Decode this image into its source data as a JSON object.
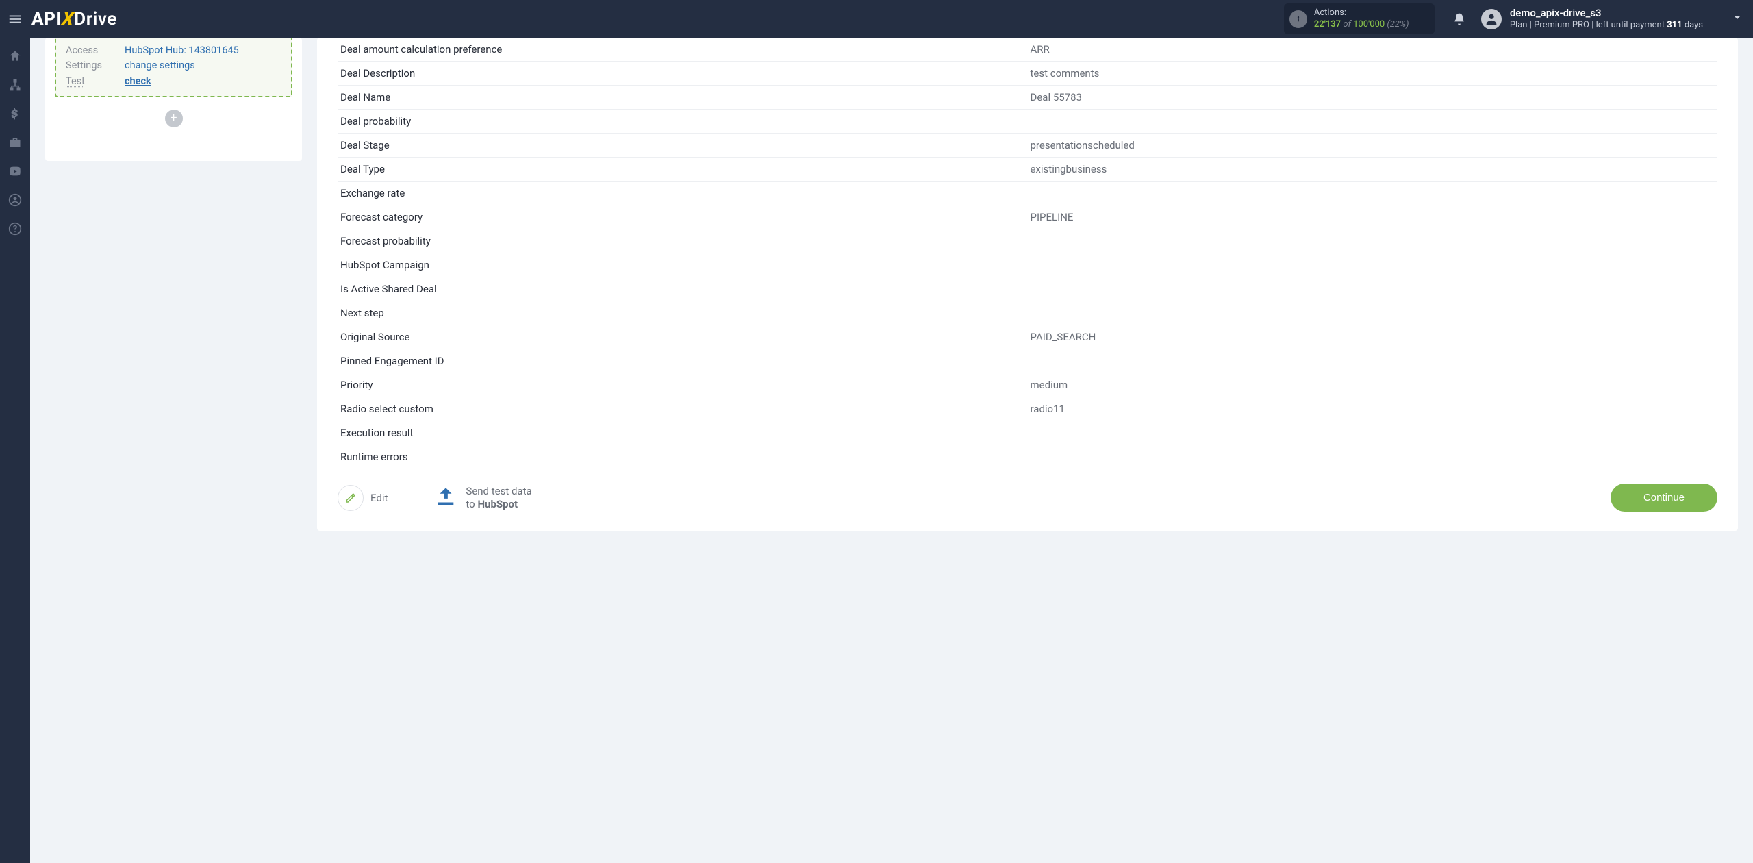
{
  "header": {
    "logo_pre": "API",
    "logo_x": "X",
    "logo_post": "Drive",
    "actions_label": "Actions:",
    "actions_used": "22'137",
    "actions_of": " of ",
    "actions_total": "100'000",
    "actions_pct": " (22%)",
    "user_name": "demo_apix-drive_s3",
    "plan_prefix": "Plan |",
    "plan_name": "Premium PRO",
    "plan_mid": "| left until payment ",
    "plan_days": "311",
    "plan_suffix": " days"
  },
  "sidebar": {
    "icons": [
      "home",
      "sitemap",
      "dollar",
      "briefcase",
      "youtube",
      "user",
      "help"
    ]
  },
  "step": {
    "access_label": "Access",
    "access_value": "HubSpot Hub: 143801645",
    "settings_label": "Settings",
    "settings_value": "change settings",
    "test_label": "Test",
    "test_value": "check"
  },
  "rows": [
    {
      "k": "Deal amount calculation preference",
      "v": "ARR"
    },
    {
      "k": "Deal Description",
      "v": "test comments"
    },
    {
      "k": "Deal Name",
      "v": "Deal 55783"
    },
    {
      "k": "Deal probability",
      "v": ""
    },
    {
      "k": "Deal Stage",
      "v": "presentationscheduled"
    },
    {
      "k": "Deal Type",
      "v": "existingbusiness"
    },
    {
      "k": "Exchange rate",
      "v": ""
    },
    {
      "k": "Forecast category",
      "v": "PIPELINE"
    },
    {
      "k": "Forecast probability",
      "v": ""
    },
    {
      "k": "HubSpot Campaign",
      "v": ""
    },
    {
      "k": "Is Active Shared Deal",
      "v": ""
    },
    {
      "k": "Next step",
      "v": ""
    },
    {
      "k": "Original Source",
      "v": "PAID_SEARCH"
    },
    {
      "k": "Pinned Engagement ID",
      "v": ""
    },
    {
      "k": "Priority",
      "v": "medium"
    },
    {
      "k": "Radio select custom",
      "v": "radio11"
    },
    {
      "k": "Execution result",
      "v": ""
    },
    {
      "k": "Runtime errors",
      "v": ""
    }
  ],
  "actions": {
    "edit_label": "Edit",
    "send_line1": "Send test data",
    "send_line2_pre": "to ",
    "send_line2_bold": "HubSpot",
    "continue_label": "Continue"
  }
}
